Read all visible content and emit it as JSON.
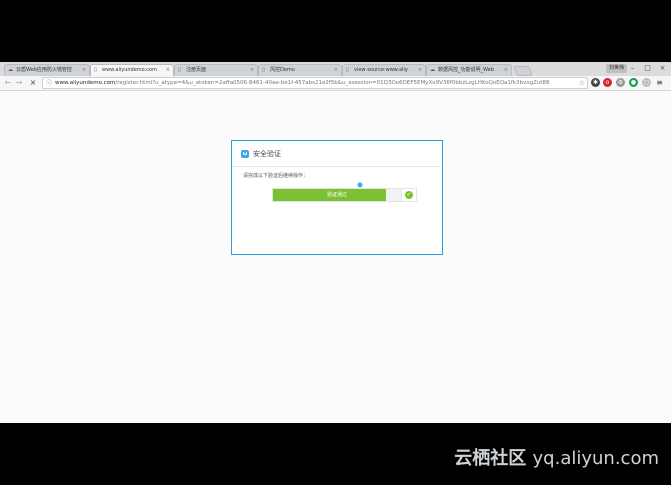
{
  "tabs": [
    {
      "label": "云盾Web应用防火墙管控",
      "icon": "cloud"
    },
    {
      "label": "www.aliyundemo.com",
      "icon": "page",
      "active": true
    },
    {
      "label": "注册页面",
      "icon": "page"
    },
    {
      "label": "风控Demo",
      "icon": "page"
    },
    {
      "label": "view-source:www.aliy",
      "icon": "page"
    },
    {
      "label": "数据风控_功能说明_Web",
      "icon": "cloud"
    }
  ],
  "window": {
    "user_label": "刘世伟"
  },
  "address_bar": {
    "host": "www.aliyundemo.com",
    "path": "/register.html?u_atype=4&u_atoken=2affa0506-8461-40ae-be1f-457abs21e2f5b&u_asession=01Q3Oo6DEF5EMyXo9V36f0bbzLzgLHKoQoEQa1fk3bvogZut88"
  },
  "dialog": {
    "title": "安全验证",
    "prompt": "请完成以下验证后继续操作：",
    "slider_label": "验证通过",
    "slider_progress": 1.0
  },
  "watermark": {
    "brand": "云栖社区",
    "domain": "yq.aliyun.com"
  },
  "colors": {
    "accent_border": "#2a9fd6",
    "success_green": "#7ac231"
  }
}
